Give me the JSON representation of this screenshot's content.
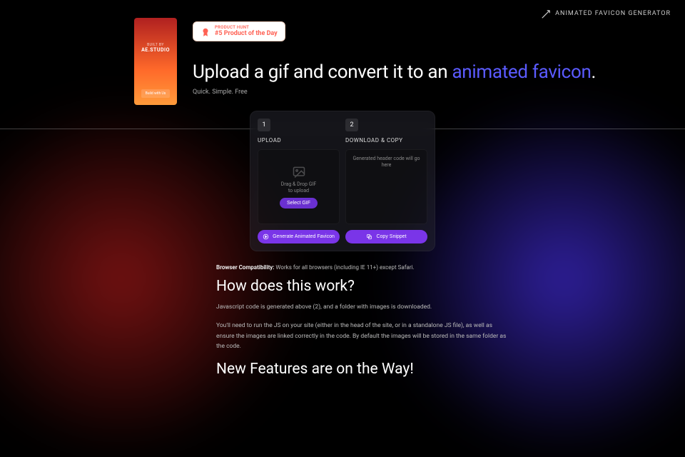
{
  "header": {
    "brand": "ANIMATED FAVICON GENERATOR"
  },
  "sidebar": {
    "built_by": "BUILT BY",
    "brand": "AE.STUDIO",
    "cta": "Build with Us"
  },
  "producthunt": {
    "label": "PRODUCT HUNT",
    "title": "#5 Product of the Day"
  },
  "hero": {
    "title_pre": "Upload a gif and convert it to an ",
    "title_accent": "animated favicon",
    "title_post": ".",
    "subtitle": "Quick. Simple. Free"
  },
  "app": {
    "step1_num": "1",
    "step1_title": "UPLOAD",
    "drop_text": "Drag & Drop GIF\nto upload",
    "select_btn": "Select GIF",
    "step2_num": "2",
    "step2_title": "DOWNLOAD & COPY",
    "output_placeholder": "Generated header code will go here",
    "generate_btn": "Generate Animated Favicon",
    "copy_btn": "Copy Snippet"
  },
  "info": {
    "compat_label": "Browser Compatibility:",
    "compat_text": " Works for all browsers (including IE 11+) except Safari.",
    "how_heading": "How does this work?",
    "how_p1": "Javascript code is generated above (2), and a folder with images is downloaded.",
    "how_p2": "You'll need to run the JS on your site (either in the head of the site, or in a standalone JS file), as well as ensure the images are linked correctly in the code. By default the images will be stored in the same folder as the code.",
    "new_heading": "New Features are on the Way!"
  }
}
